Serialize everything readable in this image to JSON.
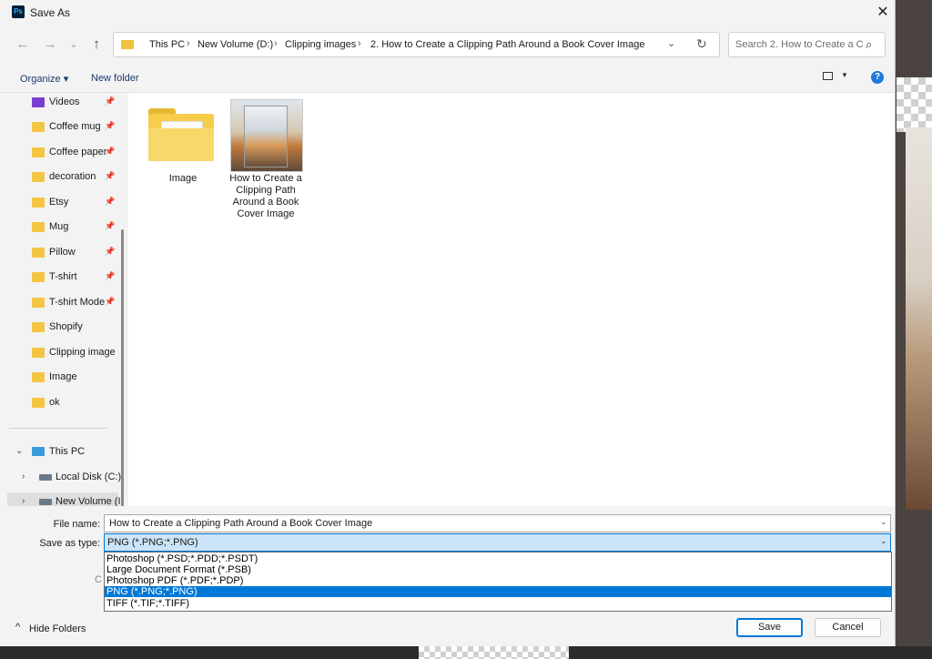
{
  "window": {
    "title": "Save As",
    "app_icon_text": "Ps",
    "close_label": "✕"
  },
  "nav": {
    "back": "←",
    "forward": "→",
    "dropdown": "⌄",
    "up": "↑"
  },
  "address": {
    "crumbs": [
      "This PC",
      "New Volume (D:)",
      "Clipping images",
      "2. How to Create a Clipping Path Around a Book Cover Image"
    ],
    "separator": "›",
    "dropdown": "⌄",
    "refresh": "↻"
  },
  "search": {
    "placeholder": "Search 2. How to Create a C...",
    "icon": "⌕"
  },
  "commands": {
    "organize": "Organize ▾",
    "new_folder": "New folder",
    "help": "?"
  },
  "sidebar": {
    "items": [
      {
        "label": "Videos",
        "icon": "video-folder-icon",
        "pinned": true
      },
      {
        "label": "Coffee mug",
        "icon": "folder-icon",
        "pinned": true
      },
      {
        "label": "Coffee paper",
        "icon": "folder-icon",
        "pinned": true
      },
      {
        "label": "decoration",
        "icon": "folder-icon",
        "pinned": true
      },
      {
        "label": "Etsy",
        "icon": "folder-icon",
        "pinned": true
      },
      {
        "label": "Mug",
        "icon": "folder-icon",
        "pinned": true
      },
      {
        "label": "Pillow",
        "icon": "folder-icon",
        "pinned": true
      },
      {
        "label": "T-shirt",
        "icon": "folder-icon",
        "pinned": true
      },
      {
        "label": "T-shirt Mode",
        "icon": "folder-icon",
        "pinned": true
      },
      {
        "label": "Shopify",
        "icon": "folder-icon",
        "pinned": false
      },
      {
        "label": "Clipping images",
        "icon": "folder-icon",
        "pinned": false
      },
      {
        "label": "Image",
        "icon": "folder-icon",
        "pinned": false
      },
      {
        "label": "ok",
        "icon": "folder-icon",
        "pinned": false
      }
    ],
    "this_pc": "This PC",
    "local_disk": "Local Disk (C:)",
    "new_volume": "New Volume (I",
    "pin_glyph": "📌",
    "expand": "⌄",
    "collapse": "›"
  },
  "content": {
    "items": [
      {
        "label": "Image",
        "type": "folder"
      },
      {
        "label": "How to Create a Clipping Path Around a Book Cover Image",
        "type": "image"
      }
    ]
  },
  "form": {
    "file_name_label": "File name:",
    "file_name_value": "How to Create a Clipping Path Around a Book Cover Image",
    "save_type_label": "Save as type:",
    "save_type_value": "PNG (*.PNG;*.PNG)",
    "type_options": [
      "Photoshop (*.PSD;*.PDD;*.PSDT)",
      "Large Document Format (*.PSB)",
      "Photoshop PDF (*.PDF;*.PDP)",
      "PNG (*.PNG;*.PNG)",
      "TIFF (*.TIF;*.TIFF)"
    ],
    "selected_option": 3,
    "obscured_label": "C",
    "dropdown_glyph": "⌄"
  },
  "footer": {
    "hide_folders": "Hide Folders",
    "hide_chevron": "^",
    "save": "Save",
    "cancel": "Cancel"
  },
  "colors": {
    "accent": "#0078d7",
    "folder": "#f4c542",
    "selected_bg": "#cce4f7"
  }
}
